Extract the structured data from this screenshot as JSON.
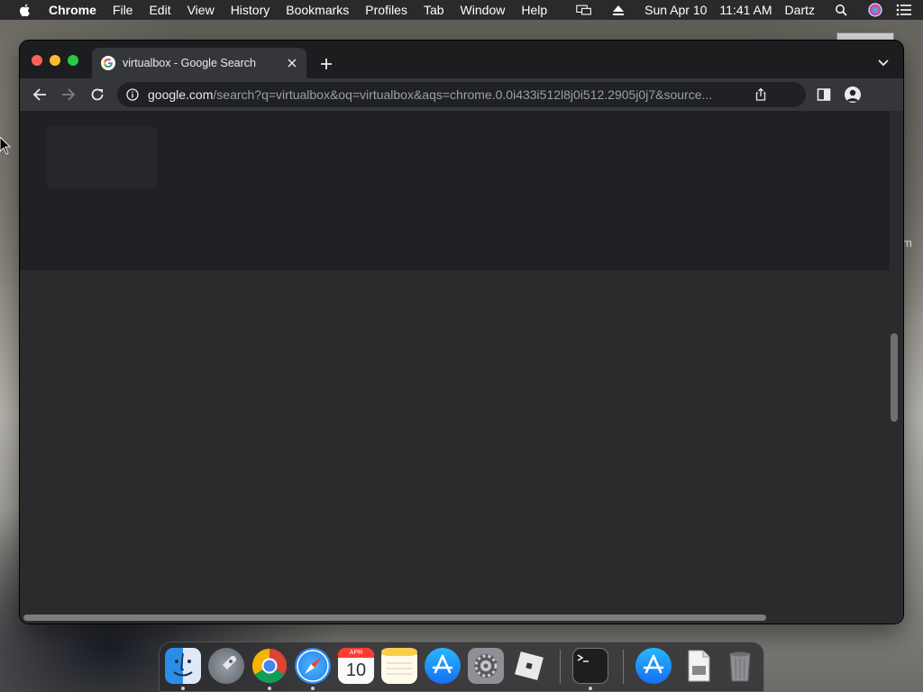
{
  "menubar": {
    "app_name": "Chrome",
    "items": [
      "File",
      "Edit",
      "View",
      "History",
      "Bookmarks",
      "Profiles",
      "Tab",
      "Window",
      "Help"
    ],
    "date": "Sun Apr 10",
    "time": "11:41 AM",
    "user": "Dartz",
    "status_icons": [
      "screen-mirroring-icon",
      "eject-icon",
      "spotlight-search-icon",
      "siri-icon",
      "control-center-icon"
    ]
  },
  "desktop": {
    "partial_label": "m"
  },
  "browser": {
    "tab_title": "virtualbox - Google Search",
    "url_host": "google.com",
    "url_rest": "/search?q=virtualbox&oq=virtualbox&aqs=chrome.0.0i433i512l8j0i512.2905j0j7&source..."
  },
  "dock": {
    "apps": [
      {
        "name": "Finder",
        "icon": "finder-icon",
        "running": true
      },
      {
        "name": "Launchpad",
        "icon": "launchpad-icon",
        "running": false
      },
      {
        "name": "Google Chrome",
        "icon": "chrome-icon",
        "running": true
      },
      {
        "name": "Safari",
        "icon": "safari-icon",
        "running": true
      },
      {
        "name": "Calendar",
        "icon": "calendar-icon",
        "running": false,
        "month": "APR",
        "day": "10"
      },
      {
        "name": "Notes",
        "icon": "notes-icon",
        "running": false
      },
      {
        "name": "App Store",
        "icon": "app-store-icon",
        "running": false
      },
      {
        "name": "System Preferences",
        "icon": "system-preferences-icon",
        "running": false
      },
      {
        "name": "Roblox",
        "icon": "roblox-icon",
        "running": false
      },
      {
        "name": "Terminal",
        "icon": "terminal-icon",
        "running": true
      },
      {
        "name": "App Store Downloads",
        "icon": "downloads-icon",
        "running": false
      },
      {
        "name": "Document",
        "icon": "document-icon",
        "running": false
      },
      {
        "name": "Trash",
        "icon": "trash-icon",
        "running": false
      }
    ]
  },
  "colors": {
    "window_bg": "#202124",
    "toolbar_bg": "#35363a",
    "tabstrip_bg": "#1c1d1f",
    "text_primary": "#e8eaed",
    "text_secondary": "#9aa0a6"
  }
}
